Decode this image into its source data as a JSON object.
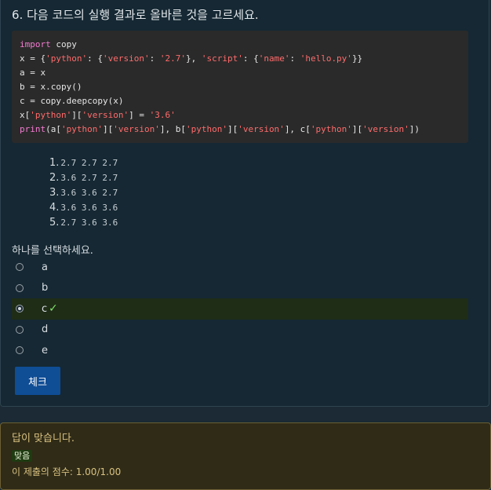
{
  "question": {
    "title": "6. 다음 코드의 실행 결과로 올바른 것을 고르세요.",
    "code_lines": [
      [
        {
          "t": "import",
          "c": "kw"
        },
        {
          "t": " copy"
        }
      ],
      [
        {
          "t": "x = {"
        },
        {
          "t": "'python'",
          "c": "str"
        },
        {
          "t": ": {"
        },
        {
          "t": "'version'",
          "c": "str"
        },
        {
          "t": ": "
        },
        {
          "t": "'2.7'",
          "c": "str"
        },
        {
          "t": "}, "
        },
        {
          "t": "'script'",
          "c": "str"
        },
        {
          "t": ": {"
        },
        {
          "t": "'name'",
          "c": "str"
        },
        {
          "t": ": "
        },
        {
          "t": "'hello.py'",
          "c": "str"
        },
        {
          "t": "}}"
        }
      ],
      [
        {
          "t": "a = x"
        }
      ],
      [
        {
          "t": "b = x.copy()"
        }
      ],
      [
        {
          "t": "c = copy.deepcopy(x)"
        }
      ],
      [
        {
          "t": "x["
        },
        {
          "t": "'python'",
          "c": "str"
        },
        {
          "t": "]["
        },
        {
          "t": "'version'",
          "c": "str"
        },
        {
          "t": "] = "
        },
        {
          "t": "'3.6'",
          "c": "str"
        }
      ],
      [
        {
          "t": "print",
          "c": "kw"
        },
        {
          "t": "(a["
        },
        {
          "t": "'python'",
          "c": "str"
        },
        {
          "t": "]["
        },
        {
          "t": "'version'",
          "c": "str"
        },
        {
          "t": "], b["
        },
        {
          "t": "'python'",
          "c": "str"
        },
        {
          "t": "]["
        },
        {
          "t": "'version'",
          "c": "str"
        },
        {
          "t": "], c["
        },
        {
          "t": "'python'",
          "c": "str"
        },
        {
          "t": "]["
        },
        {
          "t": "'version'",
          "c": "str"
        },
        {
          "t": "])"
        }
      ]
    ],
    "options": [
      {
        "num": "1.",
        "value": "2.7 2.7 2.7"
      },
      {
        "num": "2.",
        "value": "3.6 2.7 2.7"
      },
      {
        "num": "3.",
        "value": "3.6 3.6 2.7"
      },
      {
        "num": "4.",
        "value": "3.6 3.6 3.6"
      },
      {
        "num": "5.",
        "value": "2.7 3.6 3.6"
      }
    ],
    "prompt": "하나를 선택하세요.",
    "choices": [
      {
        "label": "a",
        "selected": false
      },
      {
        "label": "b",
        "selected": false
      },
      {
        "label": "c",
        "selected": true
      },
      {
        "label": "d",
        "selected": false
      },
      {
        "label": "e",
        "selected": false
      }
    ],
    "check_icon": "✓",
    "check_label": "체크"
  },
  "feedback": {
    "message": "답이 맞습니다.",
    "badge": "맞음",
    "score": "이 제출의 점수: 1.00/1.00"
  },
  "colors": {
    "keyword": "#f27bd0",
    "string": "#ff6b6b",
    "button": "#0f4d95",
    "correct": "#7fe06a",
    "feedback_text": "#d9c180"
  }
}
